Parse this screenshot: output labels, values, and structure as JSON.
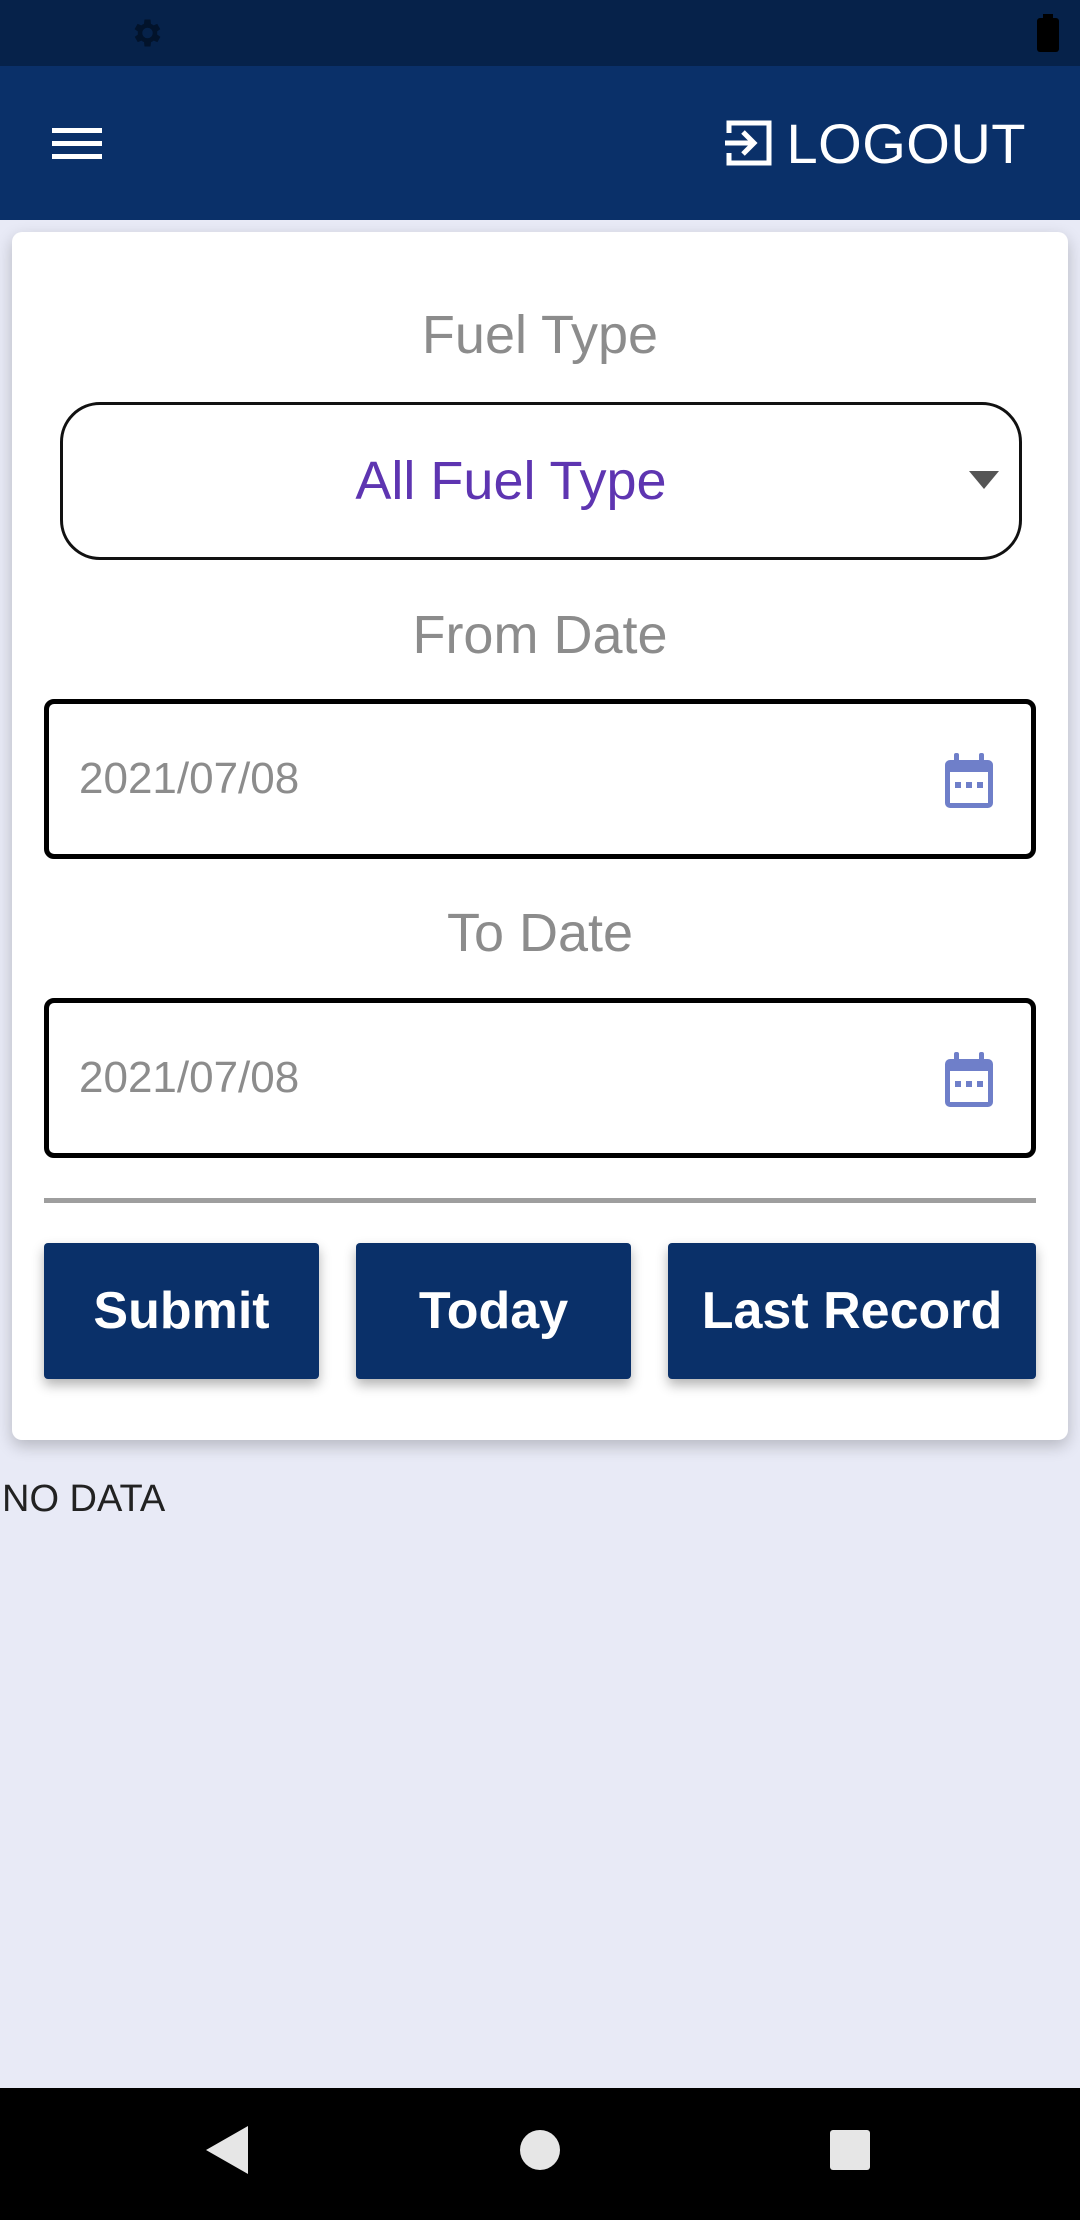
{
  "status_bar": {
    "icons": [
      "gear-icon",
      "battery-icon"
    ]
  },
  "app_bar": {
    "menu_icon": "hamburger-menu-icon",
    "logout_label": "LOGOUT",
    "logout_icon": "logout-icon"
  },
  "form": {
    "fuel_type_label": "Fuel Type",
    "fuel_type_value": "All Fuel Type",
    "from_date_label": "From Date",
    "from_date_value": "2021/07/08",
    "to_date_label": "To Date",
    "to_date_value": "2021/07/08",
    "buttons": {
      "submit": "Submit",
      "today": "Today",
      "last_record": "Last Record"
    }
  },
  "result": {
    "message": "NO DATA"
  },
  "colors": {
    "primary": "#0a3069",
    "status_bar": "#06224a",
    "accent_text": "#5e35b1",
    "calendar_icon": "#6f7fc9",
    "background": "#e8eaf6"
  }
}
